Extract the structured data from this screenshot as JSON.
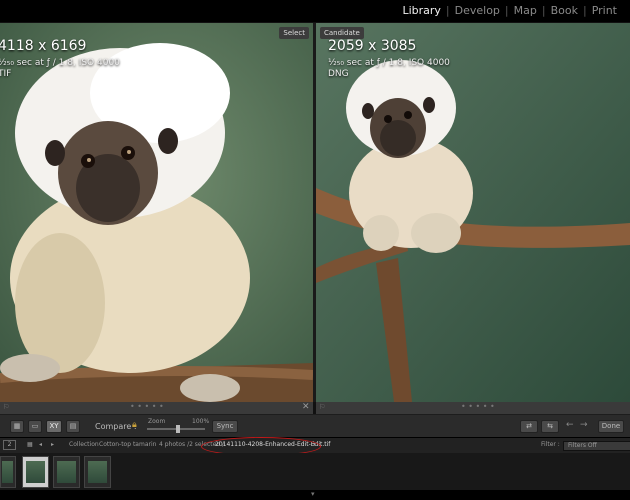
{
  "modules": [
    {
      "label": "Library",
      "active": true
    },
    {
      "label": "Develop",
      "active": false
    },
    {
      "label": "Map",
      "active": false
    },
    {
      "label": "Book",
      "active": false
    },
    {
      "label": "Print",
      "active": false
    }
  ],
  "select_pane": {
    "tag": "Select",
    "dimensions": "4118 x 6169",
    "exposure": "⅟₂₅₀ sec at ƒ / 1.8, ISO 4000",
    "format": "TIF"
  },
  "candidate_pane": {
    "tag": "Candidate",
    "dimensions": "2059 x 3085",
    "exposure": "⅟₂₅₀ sec at ƒ / 1.8, ISO 4000",
    "format": "DNG"
  },
  "toolbar": {
    "compare_label": "Compare :",
    "zoom_label": "Zoom",
    "zoom_value": "100%",
    "sync_label": "Sync",
    "done_label": "Done"
  },
  "filmstrip_bar": {
    "page": "2",
    "collection_label": "Collection",
    "collection_name": "Cotton-top tamarin",
    "photo_count": "4 photos /2 selected /",
    "filename": "20141110-4208-Enhanced-Edit-Edit.tif",
    "filter_label": "Filter :",
    "filter_value": "Filters Off"
  },
  "colors": {
    "active_module": "#f0f0f0",
    "highlight": "#c01a1a",
    "background": "#111111"
  },
  "icons": [
    "close-icon",
    "arrow-left-icon",
    "arrow-right-icon",
    "grid-view-icon",
    "loupe-view-icon",
    "compare-view-icon",
    "survey-view-icon",
    "swap-icon",
    "make-select-icon",
    "chevron-down-icon"
  ]
}
